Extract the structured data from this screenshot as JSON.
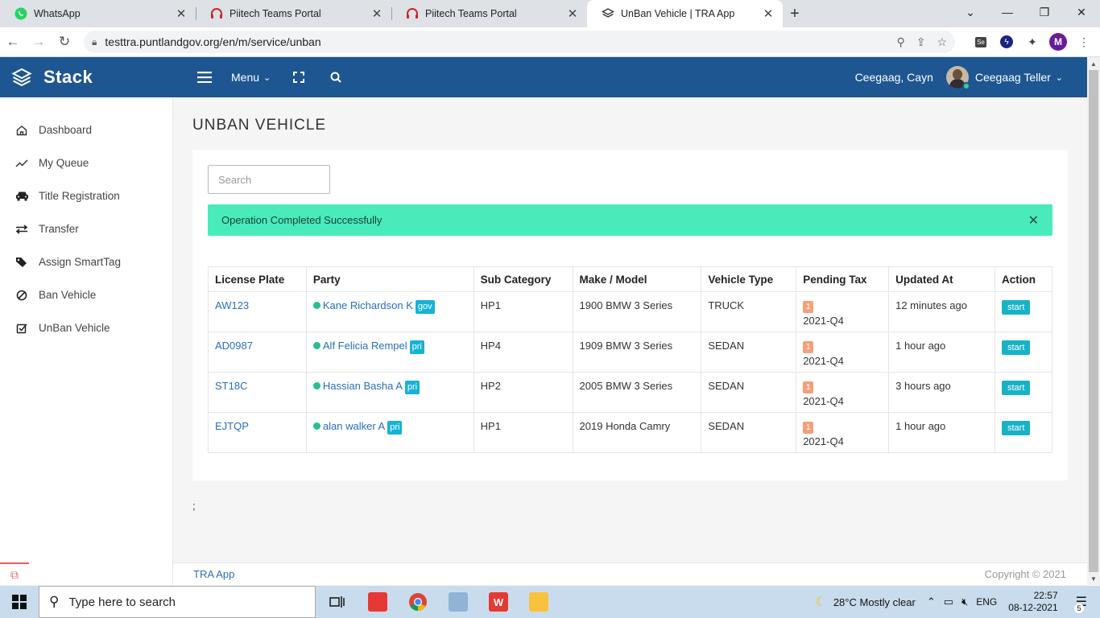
{
  "browser": {
    "tabs": [
      {
        "title": "WhatsApp",
        "icon": "whatsapp-icon",
        "color": "#25d366"
      },
      {
        "title": "Piitech Teams Portal",
        "icon": "headset-icon",
        "color": "#c62828"
      },
      {
        "title": "Piitech Teams Portal",
        "icon": "headset-icon",
        "color": "#c62828"
      },
      {
        "title": "UnBan Vehicle | TRA App",
        "icon": "layers-icon",
        "color": "#333333"
      }
    ],
    "url": "testtra.puntlandgov.org/en/m/service/unban",
    "profile_initial": "M"
  },
  "app": {
    "brand": "Stack",
    "menu_label": "Menu",
    "user_name": "Ceegaag, Cayn",
    "role": "Ceegaag Teller",
    "header_color": "#1e5691"
  },
  "sidebar": {
    "items": [
      {
        "label": "Dashboard",
        "icon": "home-icon"
      },
      {
        "label": "My Queue",
        "icon": "trend-icon"
      },
      {
        "label": "Title Registration",
        "icon": "car-icon"
      },
      {
        "label": "Transfer",
        "icon": "swap-icon"
      },
      {
        "label": "Assign SmartTag",
        "icon": "tags-icon"
      },
      {
        "label": "Ban Vehicle",
        "icon": "ban-icon"
      },
      {
        "label": "UnBan Vehicle",
        "icon": "check-square-icon"
      }
    ]
  },
  "page": {
    "title": "UNBAN VEHICLE",
    "search_placeholder": "Search",
    "alert": "Operation Completed Successfully",
    "alert_color": "#49ebbb",
    "trailing_text": ";"
  },
  "table": {
    "headers": [
      "License Plate",
      "Party",
      "Sub Category",
      "Make / Model",
      "Vehicle Type",
      "Pending Tax",
      "Updated At",
      "Action"
    ],
    "rows": [
      {
        "plate": "AW123",
        "party": "Kane Richardson K",
        "party_tag": "gov",
        "sub": "HP1",
        "model": "1900 BMW 3 Series",
        "type": "TRUCK",
        "tax_count": "1",
        "tax_period": "2021-Q4",
        "updated": "12 minutes ago",
        "action": "start"
      },
      {
        "plate": "AD0987",
        "party": "Alf Felicia Rempel",
        "party_tag": "pri",
        "sub": "HP4",
        "model": "1909 BMW 3 Series",
        "type": "SEDAN",
        "tax_count": "1",
        "tax_period": "2021-Q4",
        "updated": "1 hour ago",
        "action": "start"
      },
      {
        "plate": "ST18C",
        "party": "Hassian Basha A",
        "party_tag": "pri",
        "sub": "HP2",
        "model": "2005 BMW 3 Series",
        "type": "SEDAN",
        "tax_count": "1",
        "tax_period": "2021-Q4",
        "updated": "3 hours ago",
        "action": "start"
      },
      {
        "plate": "EJTQP",
        "party": "alan walker A",
        "party_tag": "pri",
        "sub": "HP1",
        "model": "2019 Honda Camry",
        "type": "SEDAN",
        "tax_count": "1",
        "tax_period": "2021-Q4",
        "updated": "1 hour ago",
        "action": "start"
      }
    ]
  },
  "footer": {
    "left": "TRA App",
    "right": "Copyright © 2021"
  },
  "taskbar": {
    "search_placeholder": "Type here to search",
    "weather": "28°C  Mostly clear",
    "lang": "ENG",
    "time": "22:57",
    "date": "08-12-2021",
    "notifications": "5"
  }
}
